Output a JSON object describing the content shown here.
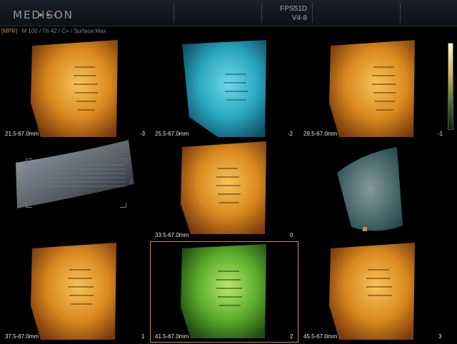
{
  "header": {
    "logo": "MEDISON",
    "probe": "FPS51D",
    "frequency": "V4-8",
    "dot_colors": [
      "#c98b3a",
      "#c98b3a",
      "#b8352a"
    ]
  },
  "info": {
    "mode": "[MPR]",
    "params": "M 100 / Th 42 / C+ / Surface:Max"
  },
  "colors": {
    "accent": "#c98b3a",
    "amber_tint": "#d98a2a",
    "cyan_tint": "#2ab3c8",
    "green_tint": "#5bb83a"
  },
  "slices": [
    {
      "range": "21.5-67.0mm",
      "index": "-3",
      "tint": "amber"
    },
    {
      "range": "25.5-67.0mm",
      "index": "-2",
      "tint": "cyan"
    },
    {
      "range": "29.5-67.0mm",
      "index": "-1",
      "tint": "amber"
    },
    {
      "range": "33.5-67.0mm",
      "index": "0",
      "tint": "amber"
    },
    {
      "range": "37.5-67.0mm",
      "index": "1",
      "tint": "amber"
    },
    {
      "range": "41.5-67.0mm",
      "index": "2",
      "tint": "green"
    },
    {
      "range": "45.5-67.0mm",
      "index": "3",
      "tint": "amber"
    }
  ],
  "reference": {
    "marker": "2"
  }
}
